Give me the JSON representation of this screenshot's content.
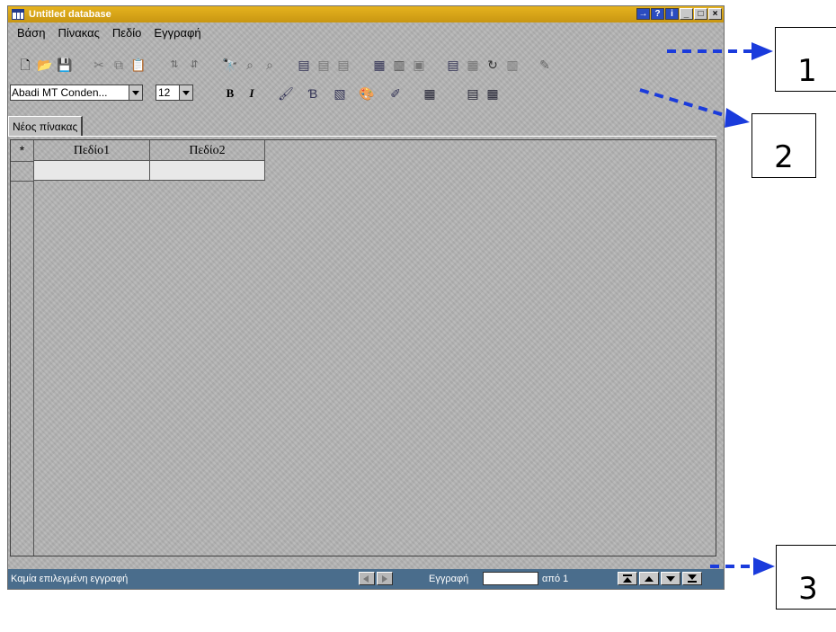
{
  "window": {
    "title": "Untitled database"
  },
  "menu": [
    "Βάση",
    "Πίνακας",
    "Πεδίο",
    "Εγγραφή"
  ],
  "toolbar2": {
    "font": "Abadi MT Conden...",
    "size": "12",
    "bold": "B",
    "italic": "I"
  },
  "tab": {
    "label": "Νέος πίνακας"
  },
  "grid": {
    "columns": [
      "Πεδίο1",
      "Πεδίο2"
    ],
    "new_row_marker": "*"
  },
  "statusbar": {
    "text": "Καμία επιλεγμένη εγγραφή",
    "record_label": "Εγγραφή",
    "record_value": "",
    "of_label": "από 1"
  },
  "callouts": [
    "1",
    "2",
    "3"
  ],
  "colors": {
    "title_bar": "#d4a318",
    "window_bg": "#b4b4b4",
    "status_bar": "#4a6d8c",
    "arrow": "#1a3bdc"
  }
}
